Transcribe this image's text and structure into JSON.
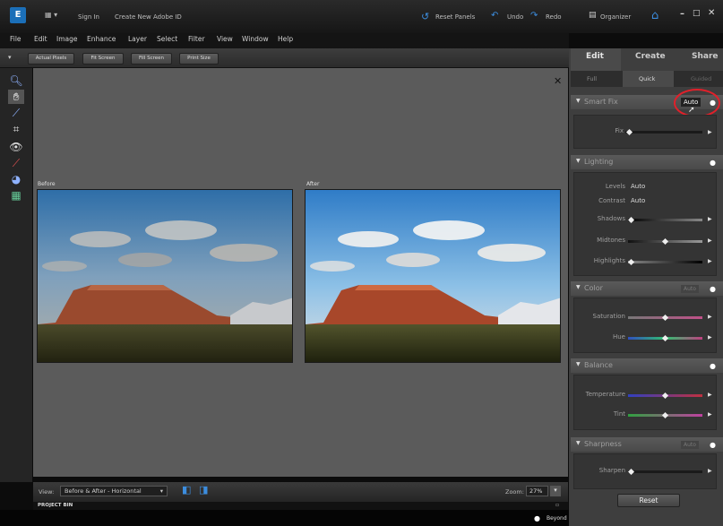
{
  "topbar": {
    "sign_in": "Sign In",
    "create_id": "Create New Adobe ID",
    "reset_panels": "Reset Panels",
    "undo": "Undo",
    "redo": "Redo",
    "organizer": "Organizer"
  },
  "menu": [
    "File",
    "Edit",
    "Image",
    "Enhance",
    "Layer",
    "Select",
    "Filter",
    "View",
    "Window",
    "Help"
  ],
  "options": {
    "actual_pixels": "Actual Pixels",
    "fit_screen": "Fit Screen",
    "fill_screen": "Fill Screen",
    "print_size": "Print Size"
  },
  "canvas": {
    "before_label": "Before",
    "after_label": "After"
  },
  "viewbar": {
    "view_label": "View:",
    "view_value": "Before & After - Horizontal",
    "zoom_label": "Zoom:",
    "zoom_value": "27%"
  },
  "project_bin": "PROJECT BIN",
  "tip": "Beyond red-eye fixes - make eyes look natural.",
  "panel": {
    "tabs": [
      "Edit",
      "Create",
      "Share"
    ],
    "subtabs": [
      "Full",
      "Quick",
      "Guided"
    ],
    "smart_fix": {
      "title": "Smart Fix",
      "auto": "Auto",
      "fix_label": "Fix"
    },
    "lighting": {
      "title": "Lighting",
      "levels_label": "Levels",
      "levels_auto": "Auto",
      "contrast_label": "Contrast",
      "contrast_auto": "Auto",
      "shadows": "Shadows",
      "midtones": "Midtones",
      "highlights": "Highlights"
    },
    "color": {
      "title": "Color",
      "auto": "Auto",
      "saturation": "Saturation",
      "hue": "Hue"
    },
    "balance": {
      "title": "Balance",
      "temperature": "Temperature",
      "tint": "Tint"
    },
    "sharpness": {
      "title": "Sharpness",
      "auto": "Auto",
      "sharpen": "Sharpen"
    },
    "reset": "Reset"
  },
  "colors": {
    "highlight_circle": "#e0202a",
    "accent_blue": "#1b6fb8"
  }
}
